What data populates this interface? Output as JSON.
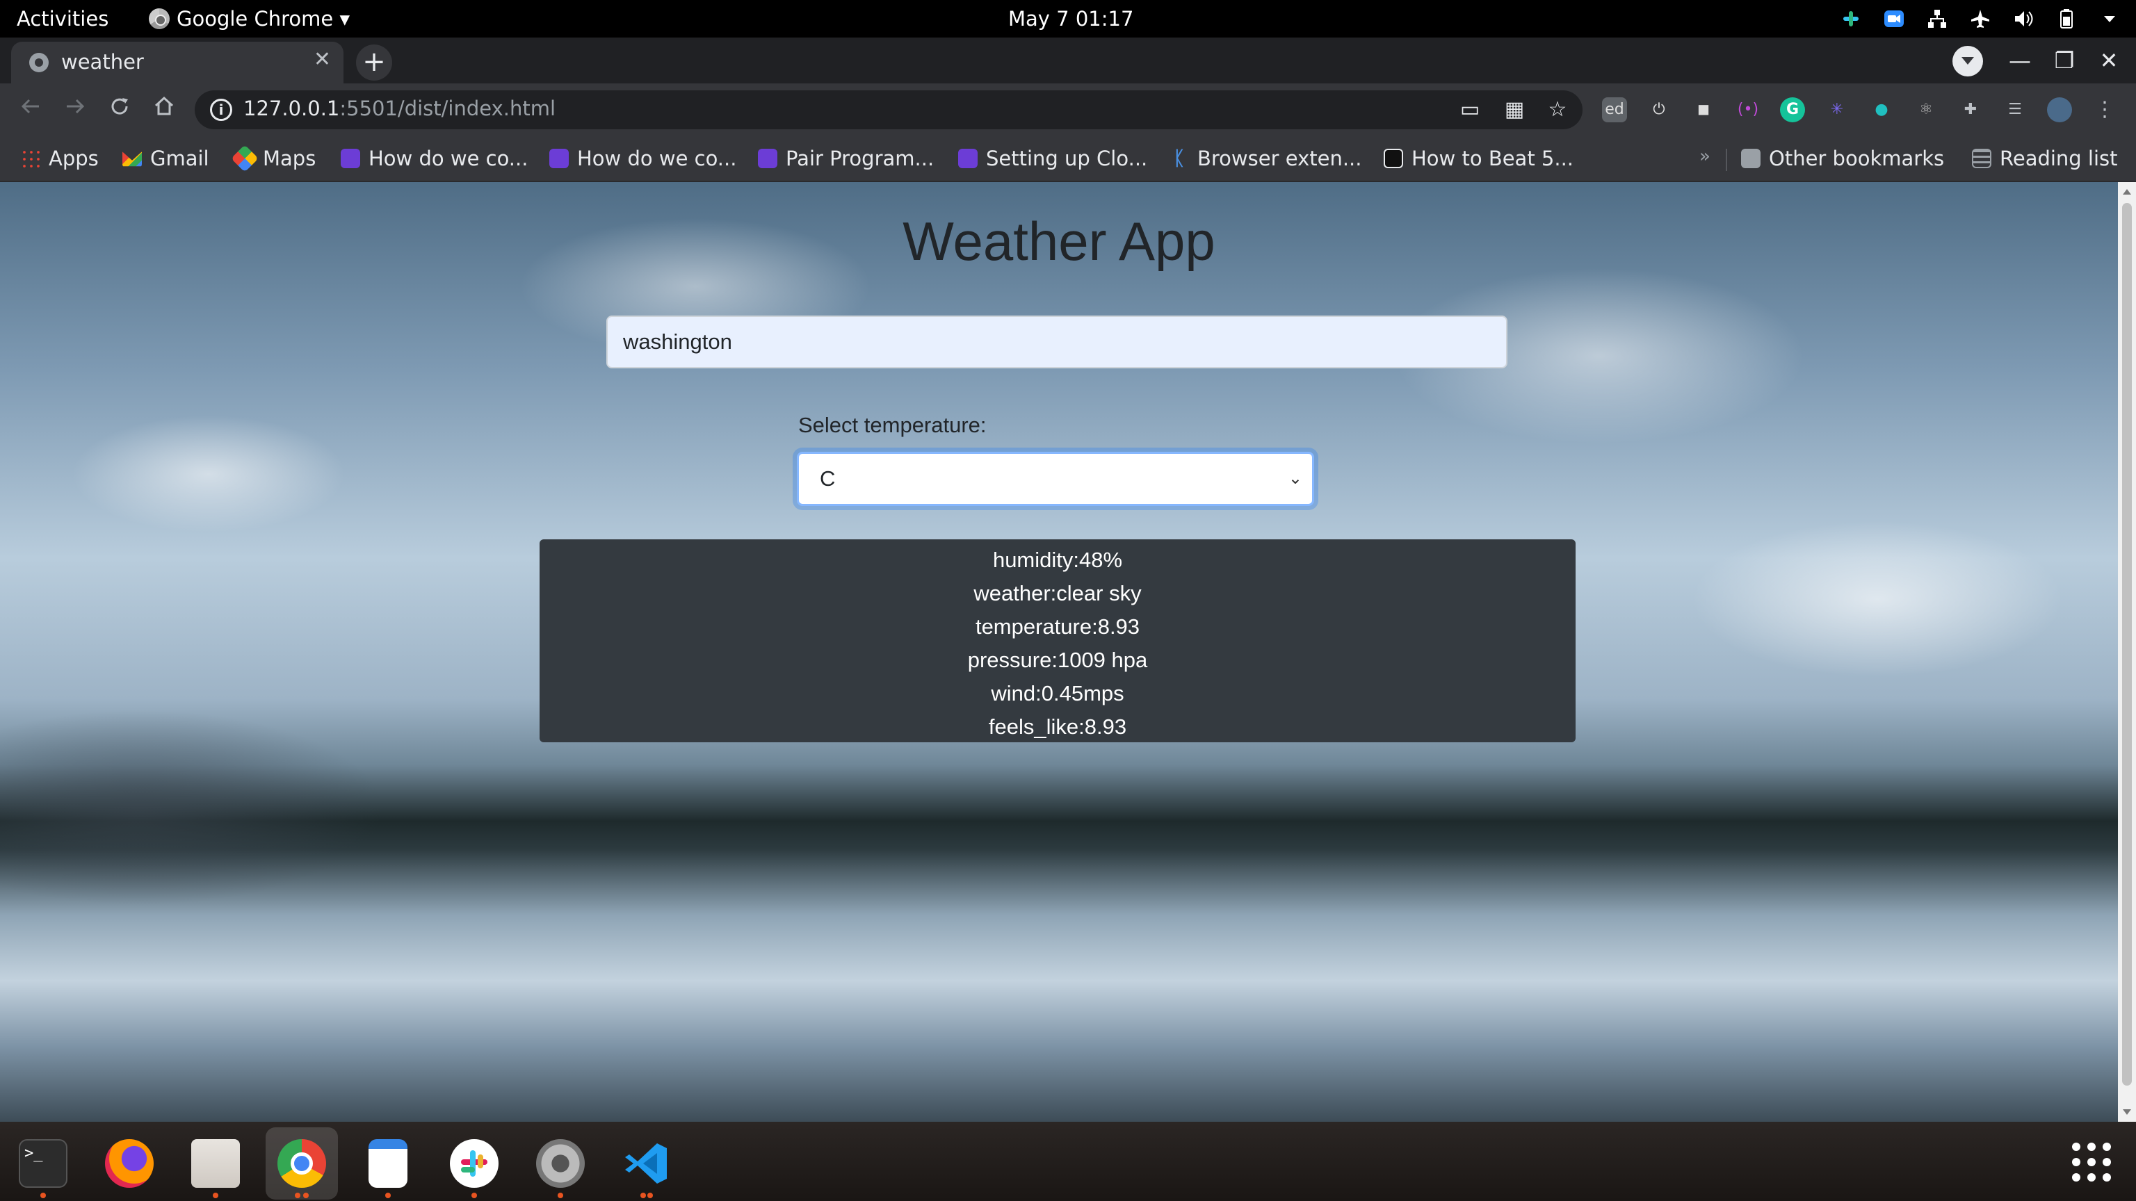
{
  "topbar": {
    "activities": "Activities",
    "app_menu": "Google Chrome ▾",
    "clock": "May 7  01:17",
    "tray_icons": [
      "slack-icon",
      "zoom-icon",
      "network-icon",
      "airplane-icon",
      "volume-icon",
      "battery-icon",
      "system-menu-icon"
    ]
  },
  "browser": {
    "tab": {
      "title": "weather",
      "close": "✕"
    },
    "new_tab": "+",
    "window_controls": {
      "minimize": "—",
      "maximize": "❐",
      "close": "✕"
    },
    "url": {
      "host": "127.0.0.1",
      "path": ":5501/dist/index.html"
    },
    "extensions": [
      "ed",
      "⏻",
      "◼",
      "(•)",
      "G",
      "✳",
      "●",
      "⚛",
      "✚",
      "☰"
    ],
    "bookmarks": [
      {
        "label": "Apps",
        "icon": "apps-icon"
      },
      {
        "label": "Gmail",
        "icon": "gmail-icon"
      },
      {
        "label": "Maps",
        "icon": "maps-icon"
      },
      {
        "label": "How do we co...",
        "icon": "purple-bookmark-icon"
      },
      {
        "label": "How do we co...",
        "icon": "purple-bookmark-icon"
      },
      {
        "label": "Pair Program...",
        "icon": "purple-bookmark-icon"
      },
      {
        "label": "Setting up Clo...",
        "icon": "purple-bookmark-icon"
      },
      {
        "label": "Browser exten...",
        "icon": "k-bookmark-icon"
      },
      {
        "label": "How to Beat 5...",
        "icon": "dark-bookmark-icon"
      }
    ],
    "bookmarks_more": "»",
    "other_bookmarks": "Other bookmarks",
    "reading_list": "Reading list"
  },
  "app": {
    "title": "Weather App",
    "search": {
      "value": "washington"
    },
    "select_label": "Select temperature:",
    "select_value": "C",
    "results": [
      "humidity:48%",
      "weather:clear sky",
      "temperature:8.93",
      "pressure:1009 hpa",
      "wind:0.45mps",
      "feels_like:8.93"
    ]
  },
  "dock": {
    "apps": [
      "terminal",
      "firefox",
      "files",
      "chrome",
      "text-editor",
      "slack",
      "settings",
      "vscode"
    ]
  }
}
